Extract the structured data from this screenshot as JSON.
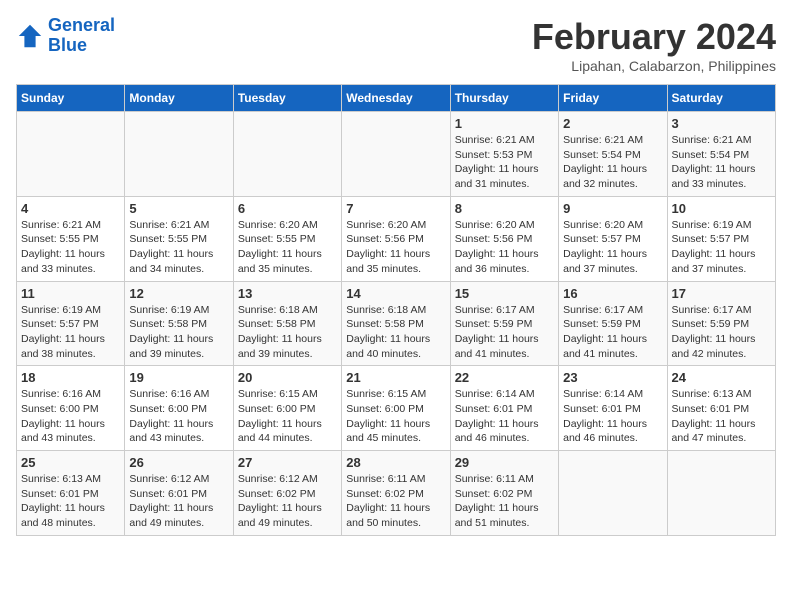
{
  "header": {
    "logo_line1": "General",
    "logo_line2": "Blue",
    "month_year": "February 2024",
    "location": "Lipahan, Calabarzon, Philippines"
  },
  "days_of_week": [
    "Sunday",
    "Monday",
    "Tuesday",
    "Wednesday",
    "Thursday",
    "Friday",
    "Saturday"
  ],
  "weeks": [
    [
      {
        "day": "",
        "info": ""
      },
      {
        "day": "",
        "info": ""
      },
      {
        "day": "",
        "info": ""
      },
      {
        "day": "",
        "info": ""
      },
      {
        "day": "1",
        "info": "Sunrise: 6:21 AM\nSunset: 5:53 PM\nDaylight: 11 hours\nand 31 minutes."
      },
      {
        "day": "2",
        "info": "Sunrise: 6:21 AM\nSunset: 5:54 PM\nDaylight: 11 hours\nand 32 minutes."
      },
      {
        "day": "3",
        "info": "Sunrise: 6:21 AM\nSunset: 5:54 PM\nDaylight: 11 hours\nand 33 minutes."
      }
    ],
    [
      {
        "day": "4",
        "info": "Sunrise: 6:21 AM\nSunset: 5:55 PM\nDaylight: 11 hours\nand 33 minutes."
      },
      {
        "day": "5",
        "info": "Sunrise: 6:21 AM\nSunset: 5:55 PM\nDaylight: 11 hours\nand 34 minutes."
      },
      {
        "day": "6",
        "info": "Sunrise: 6:20 AM\nSunset: 5:55 PM\nDaylight: 11 hours\nand 35 minutes."
      },
      {
        "day": "7",
        "info": "Sunrise: 6:20 AM\nSunset: 5:56 PM\nDaylight: 11 hours\nand 35 minutes."
      },
      {
        "day": "8",
        "info": "Sunrise: 6:20 AM\nSunset: 5:56 PM\nDaylight: 11 hours\nand 36 minutes."
      },
      {
        "day": "9",
        "info": "Sunrise: 6:20 AM\nSunset: 5:57 PM\nDaylight: 11 hours\nand 37 minutes."
      },
      {
        "day": "10",
        "info": "Sunrise: 6:19 AM\nSunset: 5:57 PM\nDaylight: 11 hours\nand 37 minutes."
      }
    ],
    [
      {
        "day": "11",
        "info": "Sunrise: 6:19 AM\nSunset: 5:57 PM\nDaylight: 11 hours\nand 38 minutes."
      },
      {
        "day": "12",
        "info": "Sunrise: 6:19 AM\nSunset: 5:58 PM\nDaylight: 11 hours\nand 39 minutes."
      },
      {
        "day": "13",
        "info": "Sunrise: 6:18 AM\nSunset: 5:58 PM\nDaylight: 11 hours\nand 39 minutes."
      },
      {
        "day": "14",
        "info": "Sunrise: 6:18 AM\nSunset: 5:58 PM\nDaylight: 11 hours\nand 40 minutes."
      },
      {
        "day": "15",
        "info": "Sunrise: 6:17 AM\nSunset: 5:59 PM\nDaylight: 11 hours\nand 41 minutes."
      },
      {
        "day": "16",
        "info": "Sunrise: 6:17 AM\nSunset: 5:59 PM\nDaylight: 11 hours\nand 41 minutes."
      },
      {
        "day": "17",
        "info": "Sunrise: 6:17 AM\nSunset: 5:59 PM\nDaylight: 11 hours\nand 42 minutes."
      }
    ],
    [
      {
        "day": "18",
        "info": "Sunrise: 6:16 AM\nSunset: 6:00 PM\nDaylight: 11 hours\nand 43 minutes."
      },
      {
        "day": "19",
        "info": "Sunrise: 6:16 AM\nSunset: 6:00 PM\nDaylight: 11 hours\nand 43 minutes."
      },
      {
        "day": "20",
        "info": "Sunrise: 6:15 AM\nSunset: 6:00 PM\nDaylight: 11 hours\nand 44 minutes."
      },
      {
        "day": "21",
        "info": "Sunrise: 6:15 AM\nSunset: 6:00 PM\nDaylight: 11 hours\nand 45 minutes."
      },
      {
        "day": "22",
        "info": "Sunrise: 6:14 AM\nSunset: 6:01 PM\nDaylight: 11 hours\nand 46 minutes."
      },
      {
        "day": "23",
        "info": "Sunrise: 6:14 AM\nSunset: 6:01 PM\nDaylight: 11 hours\nand 46 minutes."
      },
      {
        "day": "24",
        "info": "Sunrise: 6:13 AM\nSunset: 6:01 PM\nDaylight: 11 hours\nand 47 minutes."
      }
    ],
    [
      {
        "day": "25",
        "info": "Sunrise: 6:13 AM\nSunset: 6:01 PM\nDaylight: 11 hours\nand 48 minutes."
      },
      {
        "day": "26",
        "info": "Sunrise: 6:12 AM\nSunset: 6:01 PM\nDaylight: 11 hours\nand 49 minutes."
      },
      {
        "day": "27",
        "info": "Sunrise: 6:12 AM\nSunset: 6:02 PM\nDaylight: 11 hours\nand 49 minutes."
      },
      {
        "day": "28",
        "info": "Sunrise: 6:11 AM\nSunset: 6:02 PM\nDaylight: 11 hours\nand 50 minutes."
      },
      {
        "day": "29",
        "info": "Sunrise: 6:11 AM\nSunset: 6:02 PM\nDaylight: 11 hours\nand 51 minutes."
      },
      {
        "day": "",
        "info": ""
      },
      {
        "day": "",
        "info": ""
      }
    ]
  ]
}
